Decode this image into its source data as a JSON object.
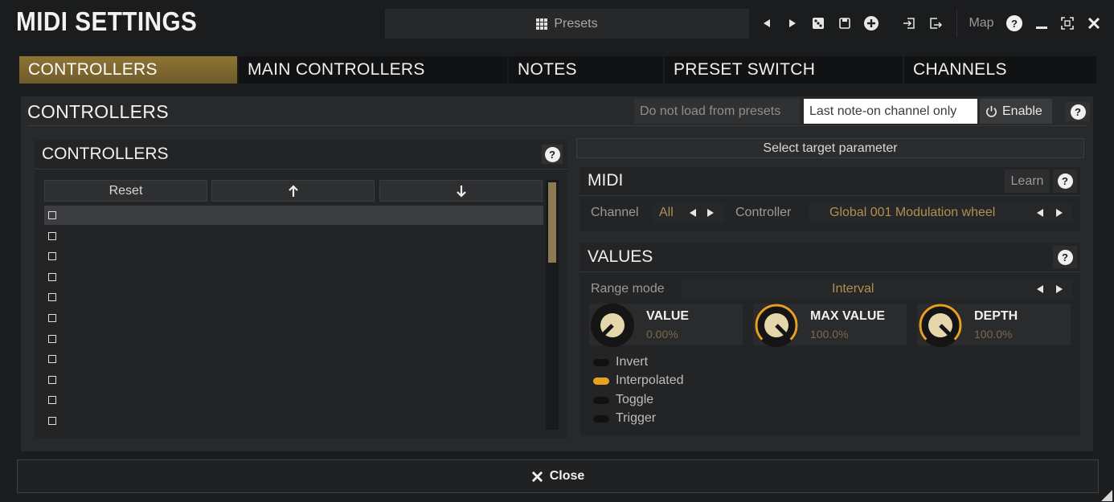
{
  "window": {
    "title": "MIDI SETTINGS",
    "presets_label": "Presets",
    "map_label": "Map",
    "icons": [
      "grid-icon",
      "prev-arrow-icon",
      "next-arrow-icon",
      "random-icon",
      "save-icon",
      "add-icon",
      "import-icon",
      "export-icon",
      "help-icon",
      "minimize-icon",
      "fullscreen-icon",
      "close-icon"
    ]
  },
  "tabs": [
    {
      "label": "CONTROLLERS",
      "active": true
    },
    {
      "label": "MAIN CONTROLLERS",
      "active": false
    },
    {
      "label": "NOTES",
      "active": false
    },
    {
      "label": "PRESET SWITCH",
      "active": false
    },
    {
      "label": "CHANNELS",
      "active": false
    }
  ],
  "section": {
    "title": "CONTROLLERS",
    "options": {
      "do_not_load": "Do not load from presets",
      "last_note_on": "Last note-on channel only",
      "enable": "Enable"
    }
  },
  "controllers_list": {
    "title": "CONTROLLERS",
    "reset_label": "Reset",
    "up_icon": "arrow-up-icon",
    "down_icon": "arrow-down-icon",
    "row_count": 11
  },
  "target": {
    "label": "Select target parameter"
  },
  "midi": {
    "title": "MIDI",
    "learn_label": "Learn",
    "channel_label": "Channel",
    "channel_value": "All",
    "controller_label": "Controller",
    "controller_value": "Global 001 Modulation wheel"
  },
  "values": {
    "title": "VALUES",
    "range_mode_label": "Range mode",
    "range_mode_value": "Interval",
    "knobs": [
      {
        "name": "VALUE",
        "value": "0.00%",
        "level": 0.0
      },
      {
        "name": "MAX VALUE",
        "value": "100.0%",
        "level": 1.0
      },
      {
        "name": "DEPTH",
        "value": "100.0%",
        "level": 1.0
      }
    ],
    "toggles": [
      {
        "label": "Invert",
        "on": false
      },
      {
        "label": "Interpolated",
        "on": true
      },
      {
        "label": "Toggle",
        "on": false
      },
      {
        "label": "Trigger",
        "on": false
      }
    ]
  },
  "footer": {
    "close_label": "Close"
  },
  "colors": {
    "accent": "#e8a020",
    "tab_active": "#8e7434",
    "value_gold": "#b09050"
  }
}
